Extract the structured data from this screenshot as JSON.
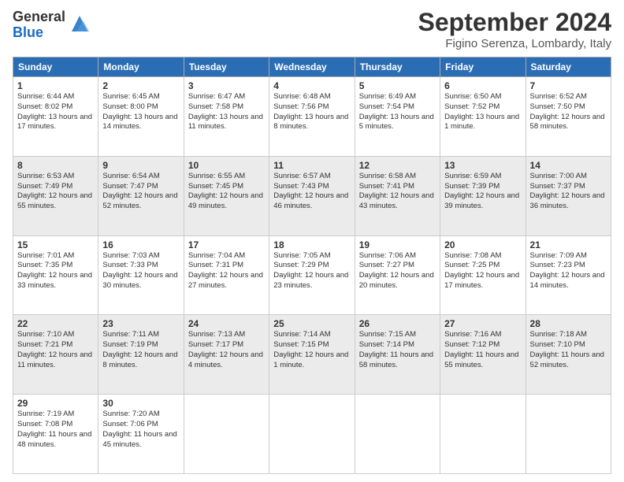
{
  "logo": {
    "general": "General",
    "blue": "Blue"
  },
  "title": "September 2024",
  "location": "Figino Serenza, Lombardy, Italy",
  "headers": [
    "Sunday",
    "Monday",
    "Tuesday",
    "Wednesday",
    "Thursday",
    "Friday",
    "Saturday"
  ],
  "weeks": [
    [
      {
        "day": "1",
        "sunrise": "6:44 AM",
        "sunset": "8:02 PM",
        "daylight": "13 hours and 17 minutes."
      },
      {
        "day": "2",
        "sunrise": "6:45 AM",
        "sunset": "8:00 PM",
        "daylight": "13 hours and 14 minutes."
      },
      {
        "day": "3",
        "sunrise": "6:47 AM",
        "sunset": "7:58 PM",
        "daylight": "13 hours and 11 minutes."
      },
      {
        "day": "4",
        "sunrise": "6:48 AM",
        "sunset": "7:56 PM",
        "daylight": "13 hours and 8 minutes."
      },
      {
        "day": "5",
        "sunrise": "6:49 AM",
        "sunset": "7:54 PM",
        "daylight": "13 hours and 5 minutes."
      },
      {
        "day": "6",
        "sunrise": "6:50 AM",
        "sunset": "7:52 PM",
        "daylight": "13 hours and 1 minute."
      },
      {
        "day": "7",
        "sunrise": "6:52 AM",
        "sunset": "7:50 PM",
        "daylight": "12 hours and 58 minutes."
      }
    ],
    [
      {
        "day": "8",
        "sunrise": "6:53 AM",
        "sunset": "7:49 PM",
        "daylight": "12 hours and 55 minutes."
      },
      {
        "day": "9",
        "sunrise": "6:54 AM",
        "sunset": "7:47 PM",
        "daylight": "12 hours and 52 minutes."
      },
      {
        "day": "10",
        "sunrise": "6:55 AM",
        "sunset": "7:45 PM",
        "daylight": "12 hours and 49 minutes."
      },
      {
        "day": "11",
        "sunrise": "6:57 AM",
        "sunset": "7:43 PM",
        "daylight": "12 hours and 46 minutes."
      },
      {
        "day": "12",
        "sunrise": "6:58 AM",
        "sunset": "7:41 PM",
        "daylight": "12 hours and 43 minutes."
      },
      {
        "day": "13",
        "sunrise": "6:59 AM",
        "sunset": "7:39 PM",
        "daylight": "12 hours and 39 minutes."
      },
      {
        "day": "14",
        "sunrise": "7:00 AM",
        "sunset": "7:37 PM",
        "daylight": "12 hours and 36 minutes."
      }
    ],
    [
      {
        "day": "15",
        "sunrise": "7:01 AM",
        "sunset": "7:35 PM",
        "daylight": "12 hours and 33 minutes."
      },
      {
        "day": "16",
        "sunrise": "7:03 AM",
        "sunset": "7:33 PM",
        "daylight": "12 hours and 30 minutes."
      },
      {
        "day": "17",
        "sunrise": "7:04 AM",
        "sunset": "7:31 PM",
        "daylight": "12 hours and 27 minutes."
      },
      {
        "day": "18",
        "sunrise": "7:05 AM",
        "sunset": "7:29 PM",
        "daylight": "12 hours and 23 minutes."
      },
      {
        "day": "19",
        "sunrise": "7:06 AM",
        "sunset": "7:27 PM",
        "daylight": "12 hours and 20 minutes."
      },
      {
        "day": "20",
        "sunrise": "7:08 AM",
        "sunset": "7:25 PM",
        "daylight": "12 hours and 17 minutes."
      },
      {
        "day": "21",
        "sunrise": "7:09 AM",
        "sunset": "7:23 PM",
        "daylight": "12 hours and 14 minutes."
      }
    ],
    [
      {
        "day": "22",
        "sunrise": "7:10 AM",
        "sunset": "7:21 PM",
        "daylight": "12 hours and 11 minutes."
      },
      {
        "day": "23",
        "sunrise": "7:11 AM",
        "sunset": "7:19 PM",
        "daylight": "12 hours and 8 minutes."
      },
      {
        "day": "24",
        "sunrise": "7:13 AM",
        "sunset": "7:17 PM",
        "daylight": "12 hours and 4 minutes."
      },
      {
        "day": "25",
        "sunrise": "7:14 AM",
        "sunset": "7:15 PM",
        "daylight": "12 hours and 1 minute."
      },
      {
        "day": "26",
        "sunrise": "7:15 AM",
        "sunset": "7:14 PM",
        "daylight": "11 hours and 58 minutes."
      },
      {
        "day": "27",
        "sunrise": "7:16 AM",
        "sunset": "7:12 PM",
        "daylight": "11 hours and 55 minutes."
      },
      {
        "day": "28",
        "sunrise": "7:18 AM",
        "sunset": "7:10 PM",
        "daylight": "11 hours and 52 minutes."
      }
    ],
    [
      {
        "day": "29",
        "sunrise": "7:19 AM",
        "sunset": "7:08 PM",
        "daylight": "11 hours and 48 minutes."
      },
      {
        "day": "30",
        "sunrise": "7:20 AM",
        "sunset": "7:06 PM",
        "daylight": "11 hours and 45 minutes."
      },
      null,
      null,
      null,
      null,
      null
    ]
  ]
}
